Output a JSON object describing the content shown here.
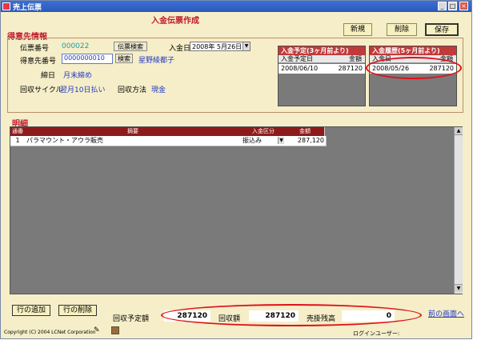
{
  "window": {
    "title": "売上伝票",
    "min": "_",
    "max": "□",
    "close": "×"
  },
  "form": {
    "heading": "入金伝票作成"
  },
  "toolbar": {
    "new": "新規",
    "delete": "削除",
    "save": "保存"
  },
  "customer": {
    "section": "得意先情報",
    "slip_no_label": "伝票番号",
    "slip_no": "000022",
    "slip_search": "伝票検索",
    "payment_date_label": "入金日",
    "payment_date": "2008年 5月26日",
    "cust_no_label": "得意先番号",
    "cust_no": "0000000010",
    "search": "検索",
    "cust_name": "星野綾都子",
    "closing_label": "締日",
    "closing": "月末締め",
    "cycle_label": "回収サイクル",
    "cycle": "翌月10日払い",
    "method_label": "回収方法",
    "method": "現金"
  },
  "scheduled": {
    "title": "入金予定(3ヶ月前より)",
    "col_date": "入金予定日",
    "col_amount": "金額",
    "rows": [
      {
        "date": "2008/06/10",
        "amount": "287120"
      }
    ]
  },
  "history": {
    "title": "入金履歴(5ヶ月前より)",
    "col_date": "入金日",
    "col_amount": "金額",
    "rows": [
      {
        "date": "2008/05/26",
        "amount": "287120"
      }
    ]
  },
  "detail": {
    "section": "明細",
    "headers": {
      "no": "通番",
      "desc": "摘要",
      "type": "入金区分",
      "amount": "金額"
    },
    "rows": [
      {
        "no": "1",
        "desc": "パラマウント・アウラ販売",
        "type": "振込み",
        "amount": "287,120"
      }
    ]
  },
  "footer": {
    "add_row": "行の追加",
    "delete_row": "行の削除",
    "planned_label": "回収予定額",
    "planned": "287120",
    "collected_label": "回収額",
    "collected": "287120",
    "balance_label": "売掛残高",
    "balance": "0",
    "back": "前の画面へ",
    "copyright": "Copyright (C) 2004 LCNet Corporation",
    "login_user": "ログインユーザー:"
  },
  "colors": {
    "accent_red": "#c0172b",
    "header_red": "#c13a3a",
    "link_blue": "#2238c8",
    "highlight": "#e0101a"
  },
  "icons": [
    "app-icon",
    "dropdown-arrow-icon",
    "scroll-up-icon",
    "scroll-down-icon",
    "pen-icon",
    "book-icon"
  ]
}
